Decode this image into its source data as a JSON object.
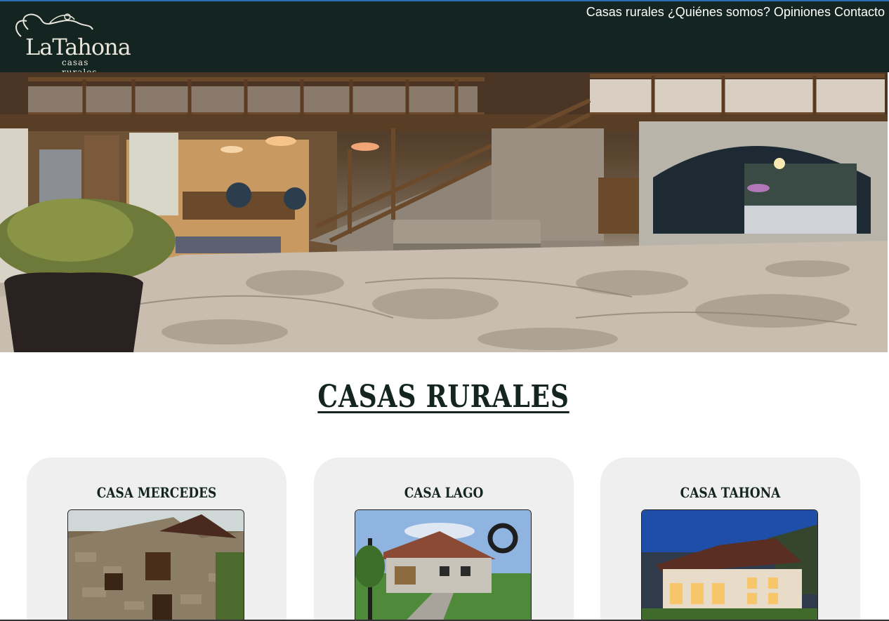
{
  "brand": {
    "logo_main": "LaTahona",
    "logo_sub": "casas rurales"
  },
  "nav": {
    "items": [
      {
        "label": "Casas rurales"
      },
      {
        "label": "¿Quiénes somos?"
      },
      {
        "label": "Opiniones"
      },
      {
        "label": "Contacto"
      }
    ]
  },
  "section": {
    "title": "CASAS RURALES"
  },
  "cards": [
    {
      "title": "CASA MERCEDES"
    },
    {
      "title": "CASA LAGO"
    },
    {
      "title": "CASA TAHONA"
    }
  ],
  "colors": {
    "header_bg": "#142420",
    "card_bg": "#efefef",
    "title_color": "#142420"
  }
}
